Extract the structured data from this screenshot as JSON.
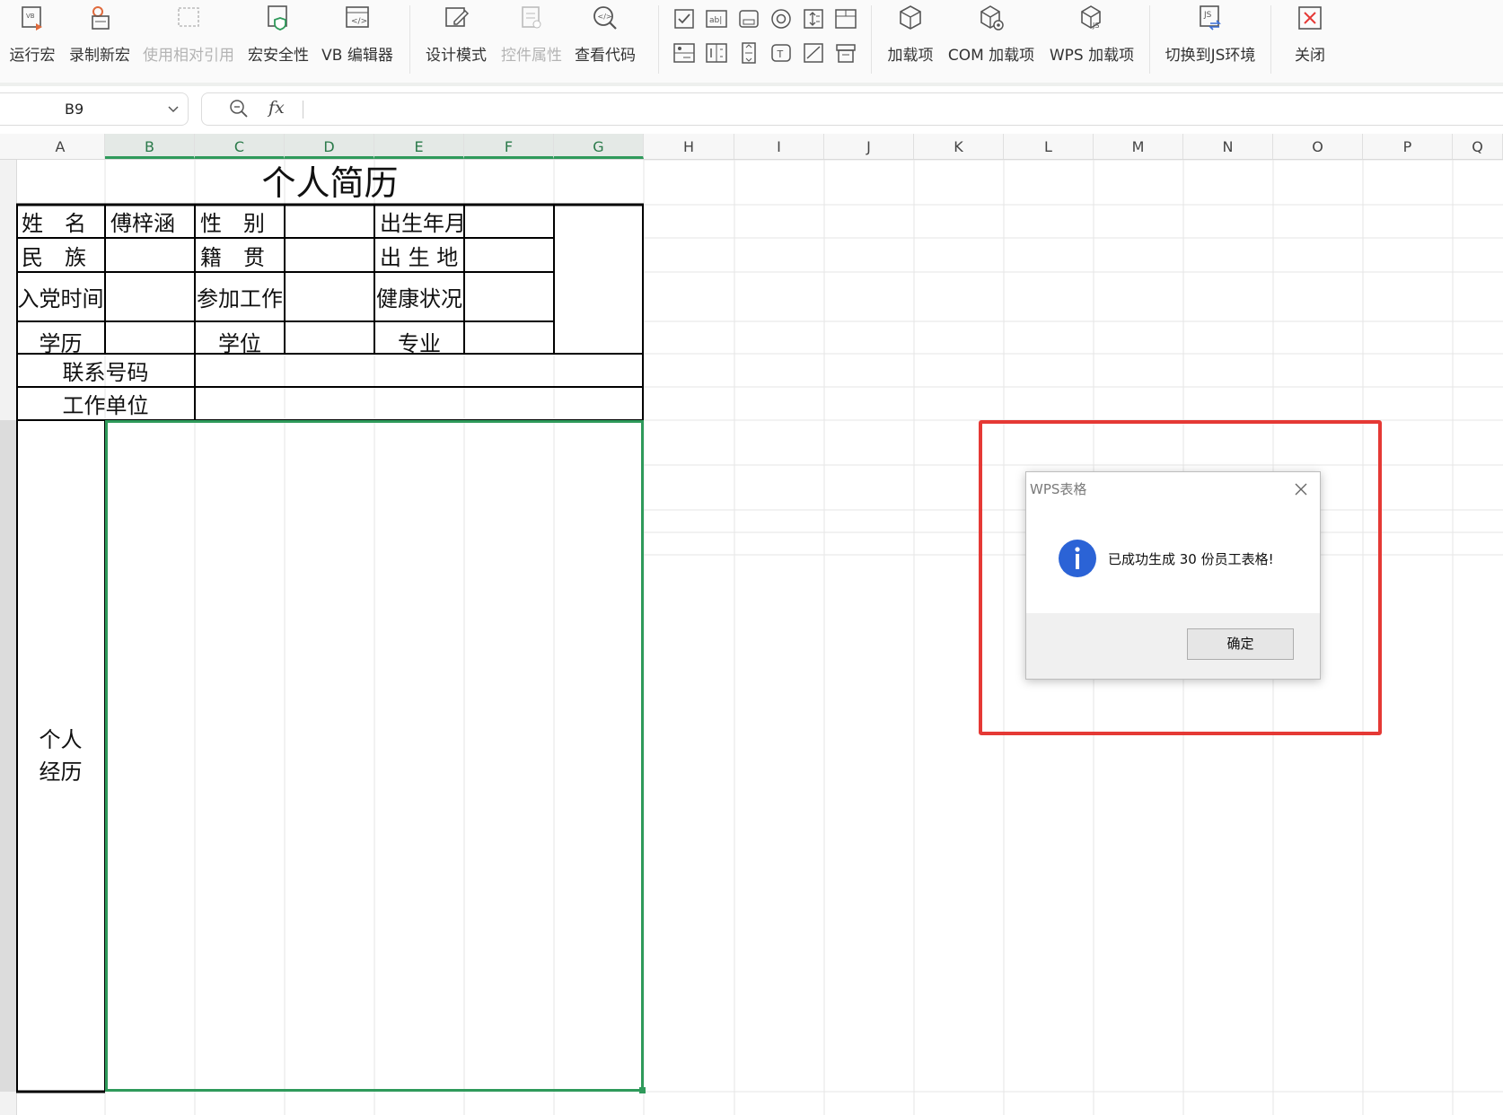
{
  "ribbon": {
    "buttons": [
      {
        "label": "运行宏",
        "icon": "run-macro-icon",
        "enabled": true
      },
      {
        "label": "录制新宏",
        "icon": "record-macro-icon",
        "enabled": true
      },
      {
        "label": "使用相对引用",
        "icon": "relative-reference-icon",
        "enabled": false
      },
      {
        "label": "宏安全性",
        "icon": "macro-security-icon",
        "enabled": true
      },
      {
        "label": "VB 编辑器",
        "icon": "vb-editor-icon",
        "enabled": true
      },
      {
        "label": "设计模式",
        "icon": "design-mode-icon",
        "enabled": true
      },
      {
        "label": "控件属性",
        "icon": "control-properties-icon",
        "enabled": false
      },
      {
        "label": "查看代码",
        "icon": "view-code-icon",
        "enabled": true
      },
      {
        "label": "加载项",
        "icon": "addins-icon",
        "enabled": true
      },
      {
        "label": "COM 加载项",
        "icon": "com-addins-icon",
        "enabled": true
      },
      {
        "label": "WPS 加载项",
        "icon": "wps-addins-icon",
        "enabled": true
      },
      {
        "label": "切换到JS环境",
        "icon": "switch-js-icon",
        "enabled": true
      },
      {
        "label": "关闭",
        "icon": "close-icon",
        "enabled": true
      }
    ],
    "controls": [
      "checkbox-control-icon",
      "textbox-control-icon",
      "button-control-icon",
      "radio-control-icon",
      "spinner-control-icon",
      "frame-control-icon",
      "combobox-control-icon",
      "listbox-control-icon",
      "scrollbar-control-icon",
      "label-control-icon",
      "image-control-icon",
      "group-control-icon"
    ]
  },
  "formula_bar": {
    "cell_ref": "B9",
    "fx": "fx",
    "formula": ""
  },
  "columns": [
    "A",
    "B",
    "C",
    "D",
    "E",
    "F",
    "G",
    "H",
    "I",
    "J",
    "K",
    "L",
    "M",
    "N",
    "O",
    "P",
    "Q"
  ],
  "selected_columns": [
    "B",
    "C",
    "D",
    "E",
    "F",
    "G"
  ],
  "resume": {
    "title": "个人简历",
    "name_label": "姓　名",
    "name_value": "傅梓涵",
    "gender_label": "性　别",
    "birth_label": "出生年月",
    "ethnic_label": "民　族",
    "native_label": "籍　贯",
    "birthplace_label": "出 生 地",
    "party_label": "入党时间",
    "work_label": "参加工作",
    "health_label": "健康状况",
    "edu_label": "学历",
    "degree_label": "学位",
    "major_label": "专业",
    "phone_label": "联系号码",
    "employer_label": "工作单位",
    "experience_label": "个人经历"
  },
  "dialog": {
    "title": "WPS表格",
    "message": "已成功生成 30 份员工表格!",
    "ok": "确定"
  },
  "colors": {
    "selection": "#2f9a5b",
    "highlight": "#e53935",
    "info": "#2b63d6"
  }
}
